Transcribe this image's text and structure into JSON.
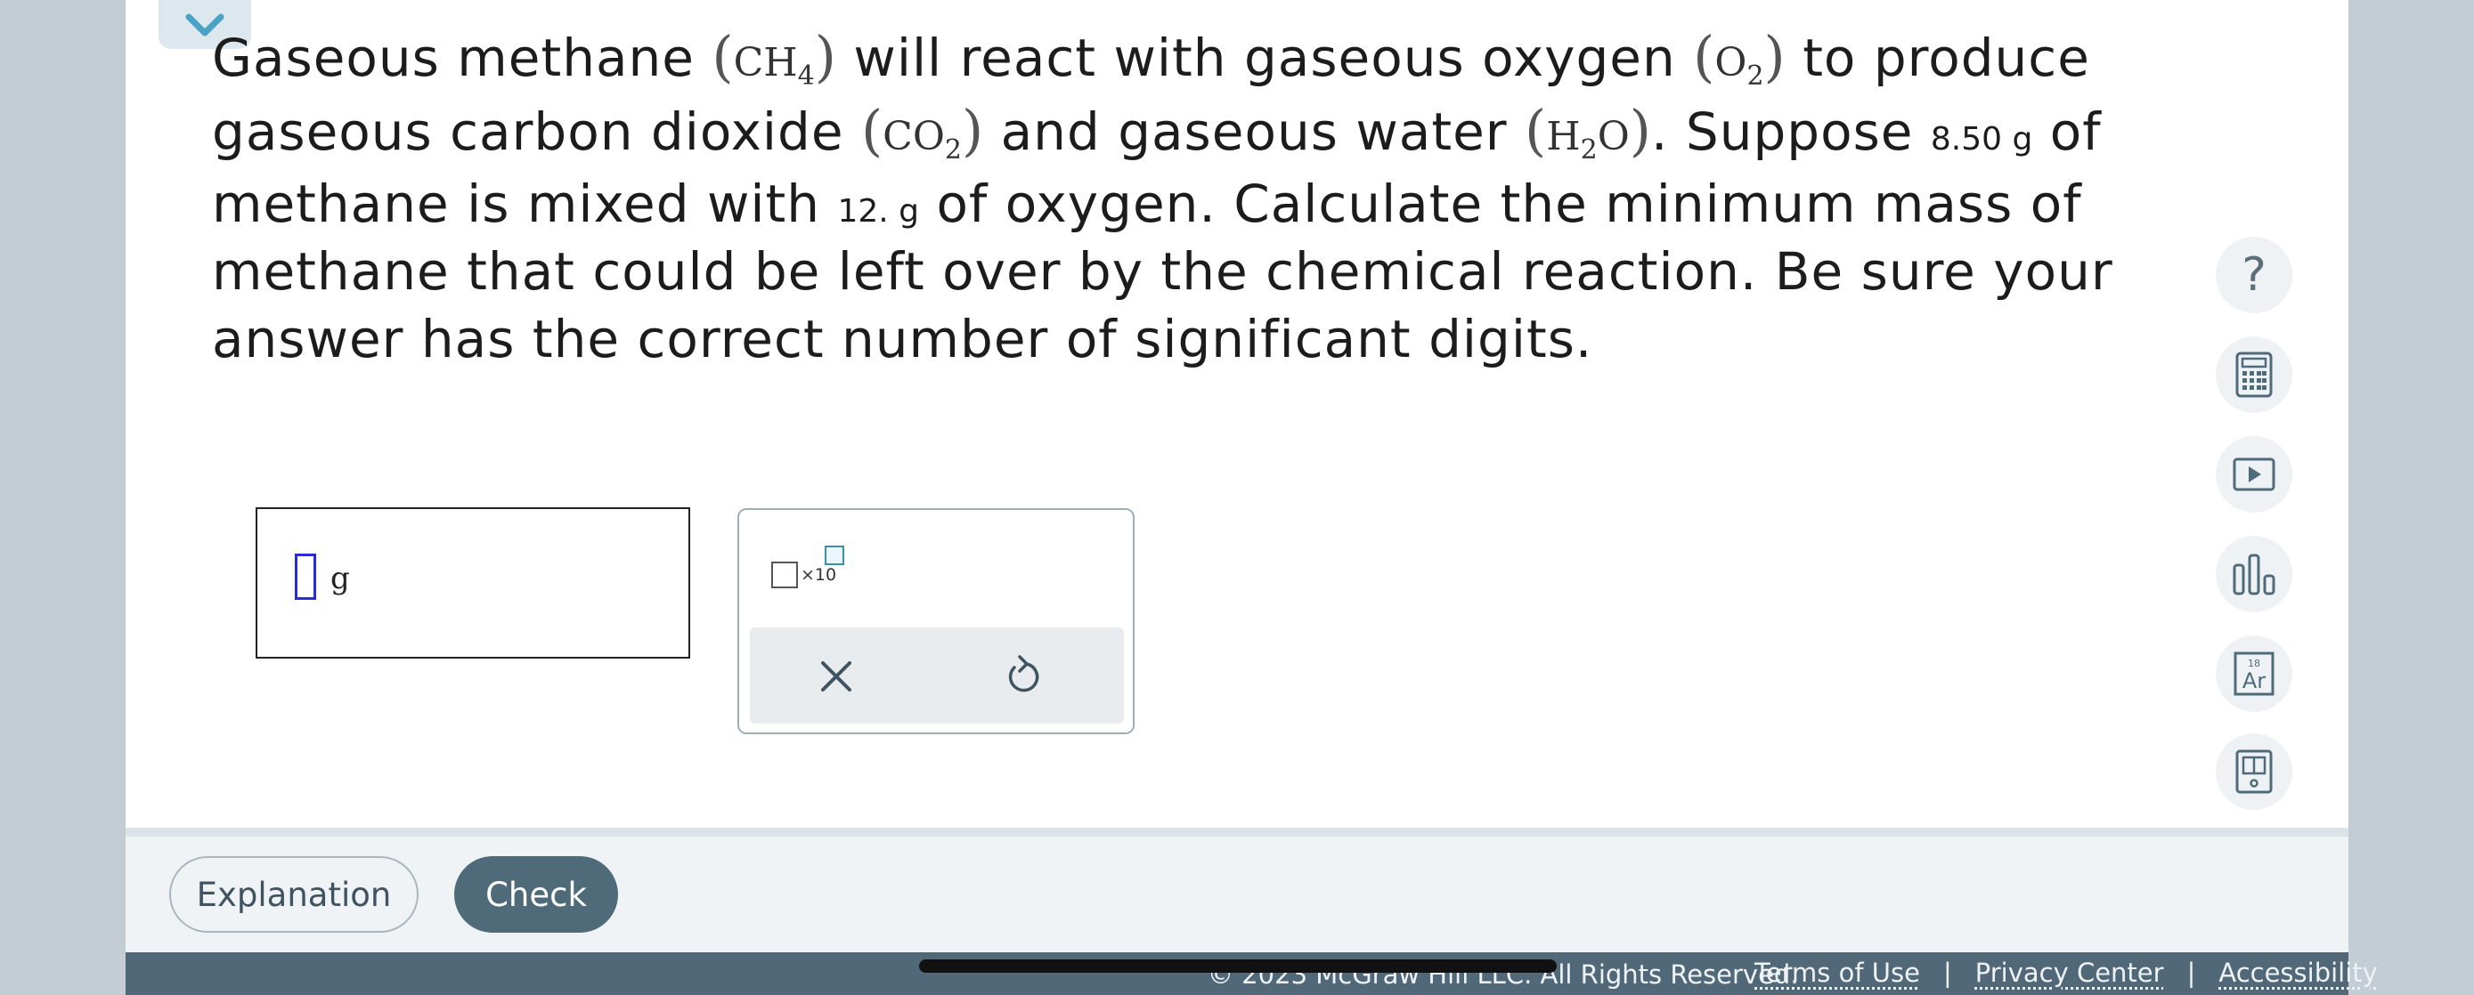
{
  "question": {
    "l1a": "Gaseous methane",
    "methane_formula": "CH",
    "methane_sub": "4",
    "l1b": "will react with gaseous oxygen",
    "oxygen_formula": "O",
    "oxygen_sub": "2",
    "l1c": "to produce",
    "l2a": "gaseous carbon dioxide",
    "co2_formula": "CO",
    "co2_sub": "2",
    "l2b": "and gaseous water",
    "water_formula_h": "H",
    "water_sub": "2",
    "water_formula_o": "O",
    "l2c": ". Suppose",
    "methane_mass": "8.50 g",
    "l2d": "of",
    "l3a": "methane is mixed with",
    "oxygen_mass": "12. g",
    "l3b": "of oxygen. Calculate the minimum mass of",
    "l4": "methane that could be left over by the chemical reaction. Be sure your",
    "l5": "answer has the correct number of significant digits."
  },
  "answer": {
    "unit": "g"
  },
  "tools": {
    "sci_multiplier": "×10"
  },
  "buttons": {
    "explanation": "Explanation",
    "check": "Check"
  },
  "side_tools": {
    "help_symbol": "?",
    "periodic_number": "18",
    "periodic_symbol": "Ar"
  },
  "footer": {
    "copyright": "© 2023 McGraw Hill LLC. All Rights Reserved.",
    "terms": "Terms of Use",
    "privacy": "Privacy Center",
    "accessibility": "Accessibility",
    "separator": "|"
  },
  "icons": [
    "chevron-down-icon",
    "close-icon",
    "undo-icon",
    "help-icon",
    "calculator-icon",
    "video-icon",
    "chart-icon",
    "periodic-table-icon",
    "reference-book-icon"
  ],
  "colors": {
    "accent": "#4f6b7a",
    "cursor": "#2b2bd9",
    "chevron": "#4aa3c4"
  }
}
